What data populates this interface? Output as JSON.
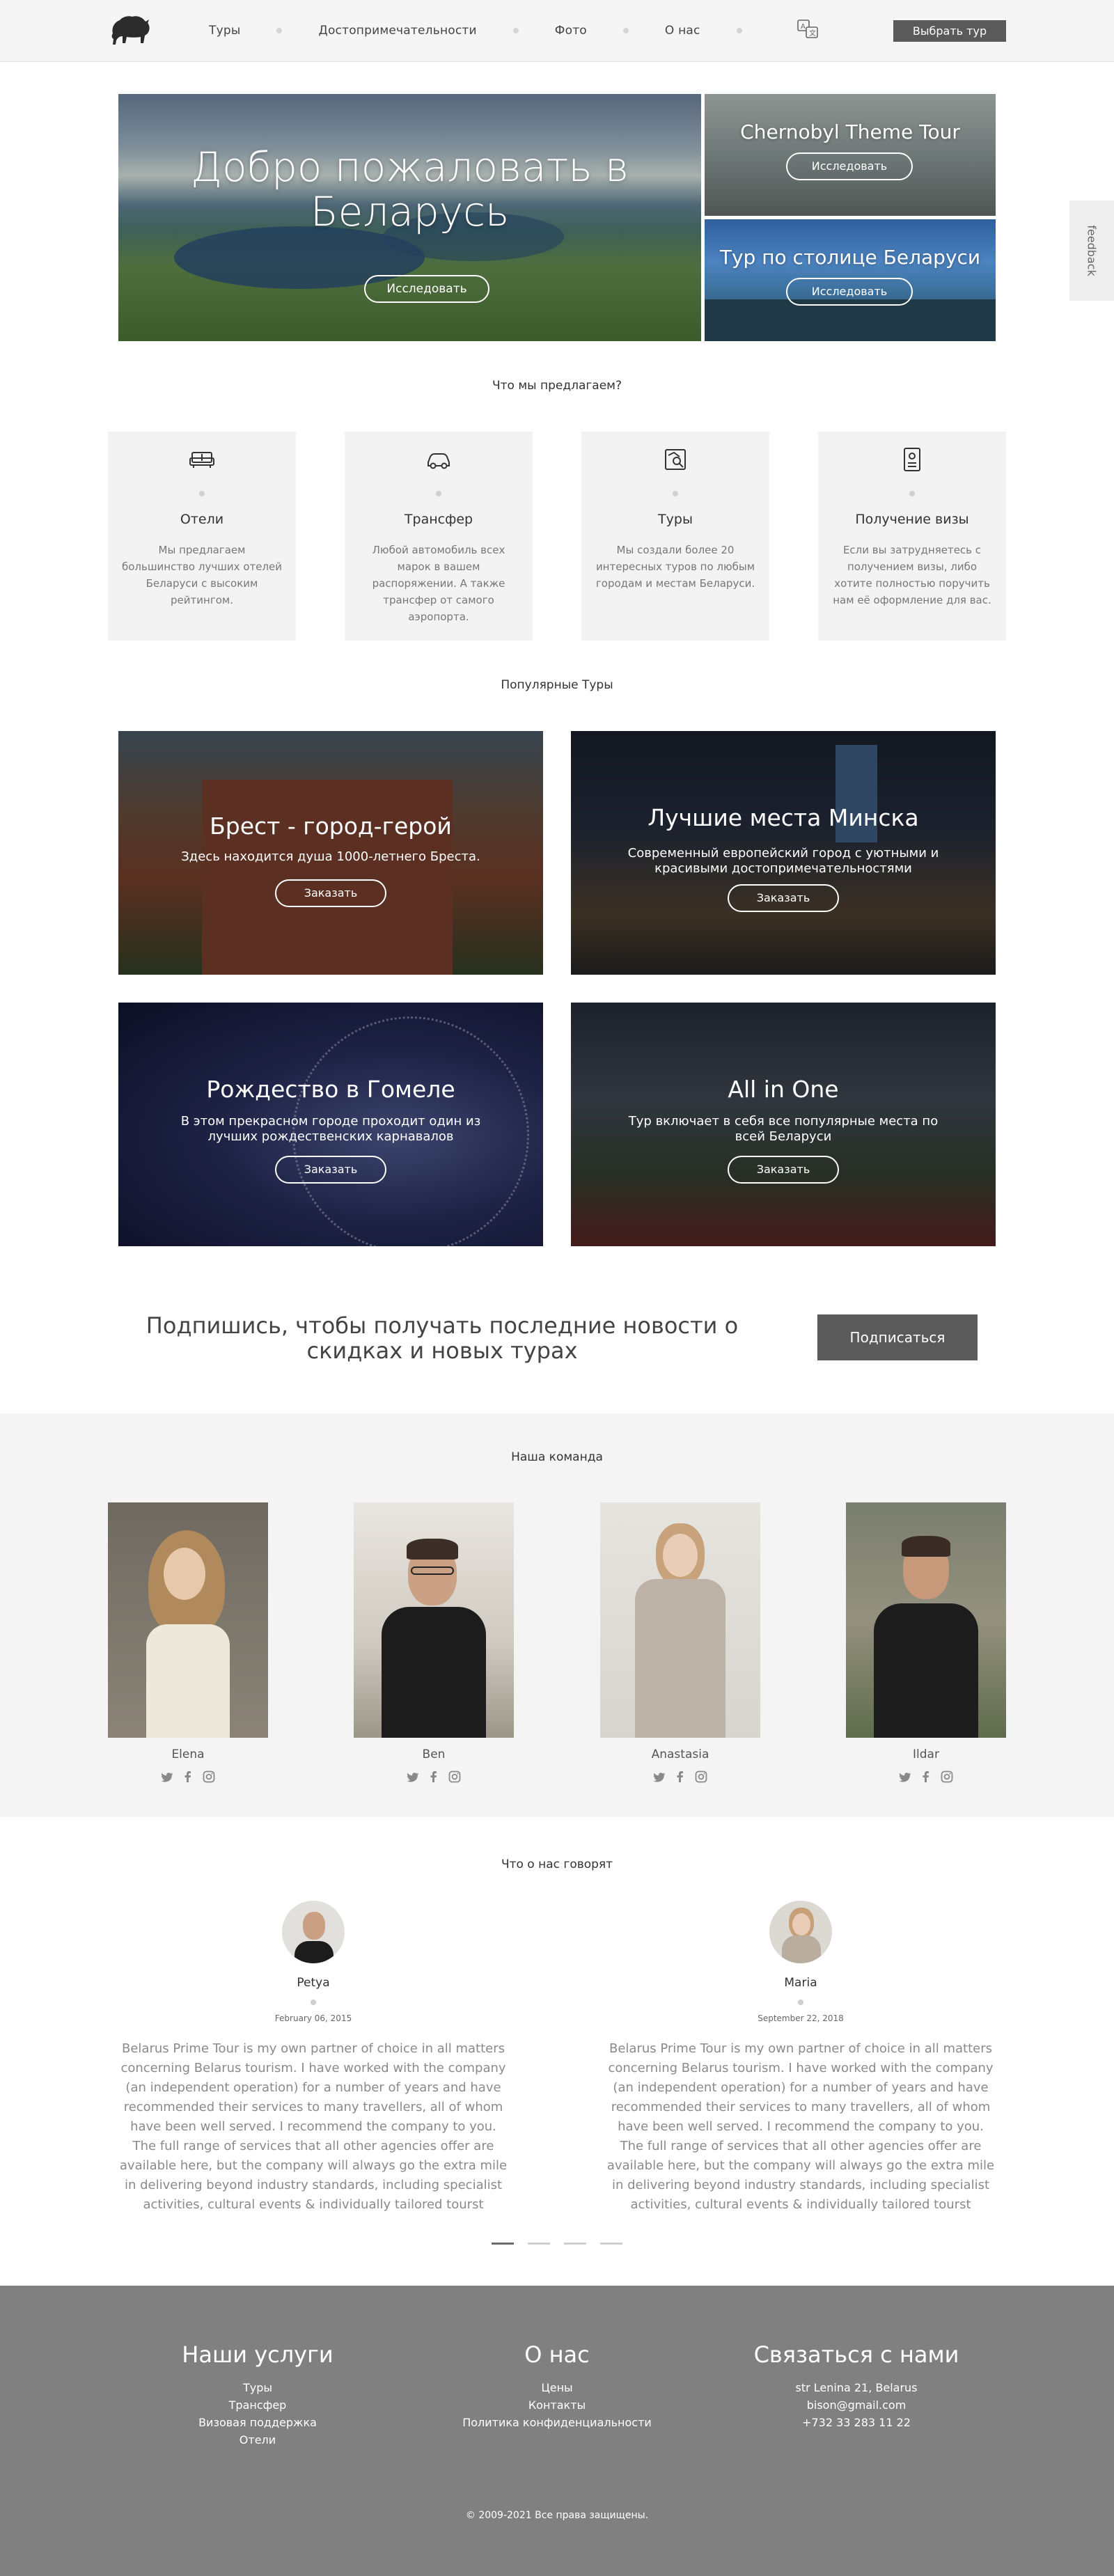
{
  "header": {
    "nav": [
      "Туры",
      "Достопримечательности",
      "Фото",
      "О нас"
    ],
    "cta_label": "Выбрать тур"
  },
  "feedback": {
    "label": "feedback"
  },
  "hero": {
    "title": "Добро пожаловать в Беларусь",
    "explore_label": "Исследовать",
    "side": [
      {
        "title": "Chernobyl Theme Tour",
        "button": "Исследовать"
      },
      {
        "title": "Тур по столице Беларуси",
        "button": "Исследовать"
      }
    ]
  },
  "services": {
    "title": "Что мы предлагаем?",
    "items": [
      {
        "icon": "sofa-icon",
        "title": "Отели",
        "text": "Мы предлагаем большинство лучших отелей Беларуси с высоким рейтингом."
      },
      {
        "icon": "car-icon",
        "title": "Трансфер",
        "text": "Любой автомобиль всех марок в вашем распоряжении. А также трансфер от самого аэропорта."
      },
      {
        "icon": "map-icon",
        "title": "Туры",
        "text": "Мы создали более 20 интересных туров по любым городам и местам Беларуси."
      },
      {
        "icon": "passport-icon",
        "title": "Получение визы",
        "text": "Если вы затрудняетесь с получением визы, либо хотите полностью поручить нам её оформление для вас."
      }
    ]
  },
  "tours": {
    "title": "Популярные Туры",
    "items": [
      {
        "title": "Брест - город-герой",
        "text": "Здесь находится душа 1000-летнего Бреста.",
        "button": "Заказать"
      },
      {
        "title": "Лучшие места Минска",
        "text": "Современный европейский город с уютными и красивыми достопримечательностями",
        "button": "Заказать"
      },
      {
        "title": "Рождество в Гомеле",
        "text": "В этом прекрасном городе проходит один из лучших рождественских карнавалов",
        "button": "Заказать"
      },
      {
        "title": "All in One",
        "text": "Тур включает в себя все популярные места по всей Беларуси",
        "button": "Заказать"
      }
    ]
  },
  "subscribe": {
    "text": "Подпишись, чтобы получать последние новости о скидках и новых турах",
    "button": "Подписаться"
  },
  "team": {
    "title": "Наша команда",
    "members": [
      "Elena",
      "Ben",
      "Anastasia",
      "Ildar"
    ]
  },
  "reviews": {
    "title": "Что о нас говорят",
    "items": [
      {
        "name": "Petya",
        "date": "February 06, 2015",
        "text": "Belarus Prime Tour is my own partner of choice in all matters concerning Belarus tourism. I have worked with the company (an independent operation) for a number of years and have recommended their services to many travellers, all of whom have been well served. I recommend the company to you. The full range of services that all other agencies offer are available here, but the company will always go the extra mile in delivering beyond industry standards, including specialist activities, cultural events & individually tailored tourst"
      },
      {
        "name": "Maria",
        "date": "September 22, 2018",
        "text": "Belarus Prime Tour is my own partner of choice in all matters concerning Belarus tourism. I have worked with the company (an independent operation) for a number of years and have recommended their services to many travellers, all of whom have been well served. I recommend the company to you. The full range of services that all other agencies offer are available here, but the company will always go the extra mile in delivering beyond industry standards, including specialist activities, cultural events & individually tailored tourst"
      }
    ]
  },
  "footer": {
    "services": {
      "title": "Наши услуги",
      "links": [
        "Туры",
        "Трансфер",
        "Визовая поддержка",
        "Отели"
      ]
    },
    "about": {
      "title": "О нас",
      "links": [
        "Цены",
        "Контакты",
        "Политика конфиденциальности"
      ]
    },
    "contact": {
      "title": "Связаться с нами",
      "links": [
        "str Lenina 21, Belarus",
        "bison@gmail.com",
        "+732 33 283 11 22"
      ]
    },
    "copyright": "© 2009-2021 Все права защищены."
  }
}
